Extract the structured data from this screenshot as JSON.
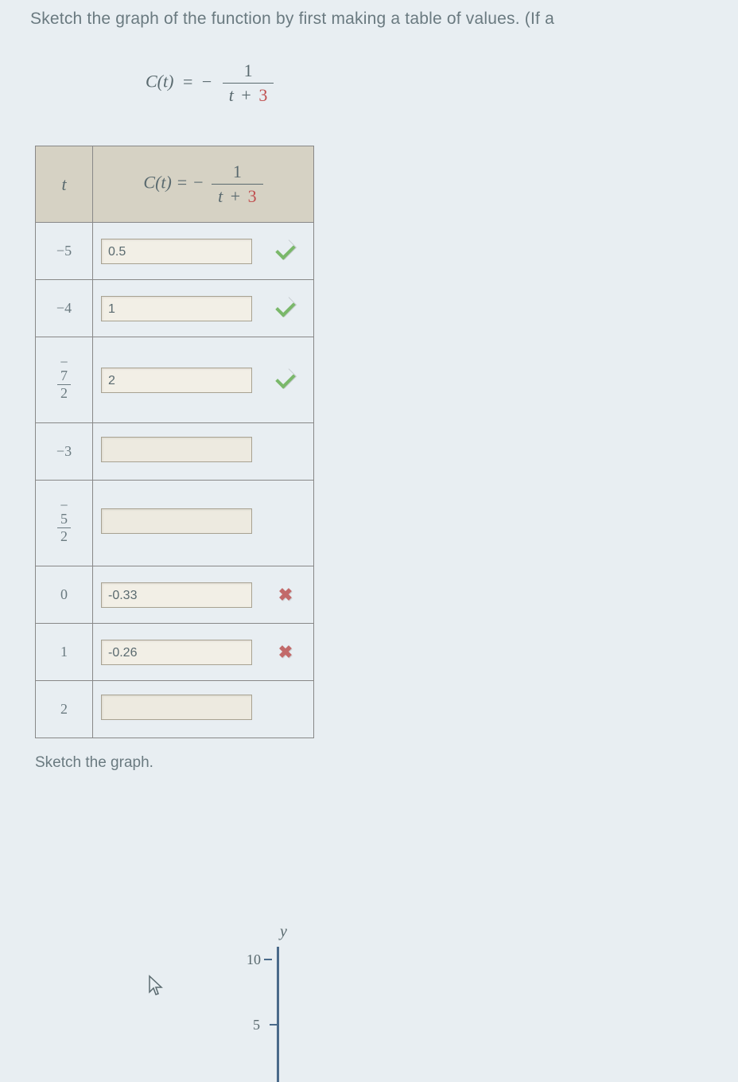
{
  "problem_text": "Sketch the graph of the function by first making a table of values. (If a",
  "equation": {
    "lhs": "C(t)",
    "eq": "=",
    "neg": "−",
    "num": "1",
    "den_var": "t",
    "den_plus": "+",
    "den_const": "3"
  },
  "table": {
    "header_t": "t",
    "header_c": {
      "lhs": "C(t)",
      "eq": "=",
      "neg": "−",
      "num": "1",
      "den_var": "t",
      "den_plus": "+",
      "den_const": "3"
    },
    "rows": [
      {
        "t_plain": "−5",
        "answer": "0.5",
        "mark": "correct"
      },
      {
        "t_plain": "−4",
        "answer": "1",
        "mark": "correct"
      },
      {
        "t_frac": {
          "minus": "−",
          "top": "7",
          "bot": "2"
        },
        "answer": "2",
        "mark": "correct"
      },
      {
        "t_plain": "−3",
        "answer": "",
        "mark": ""
      },
      {
        "t_frac": {
          "minus": "−",
          "top": "5",
          "bot": "2"
        },
        "answer": "",
        "mark": ""
      },
      {
        "t_plain": "0",
        "answer": "-0.33",
        "mark": "wrong"
      },
      {
        "t_plain": "1",
        "answer": "-0.26",
        "mark": "wrong"
      },
      {
        "t_plain": "2",
        "answer": "",
        "mark": ""
      }
    ]
  },
  "sketch_label": "Sketch the graph.",
  "graph": {
    "y_label": "y",
    "tick10": "10",
    "tick5": "5"
  }
}
